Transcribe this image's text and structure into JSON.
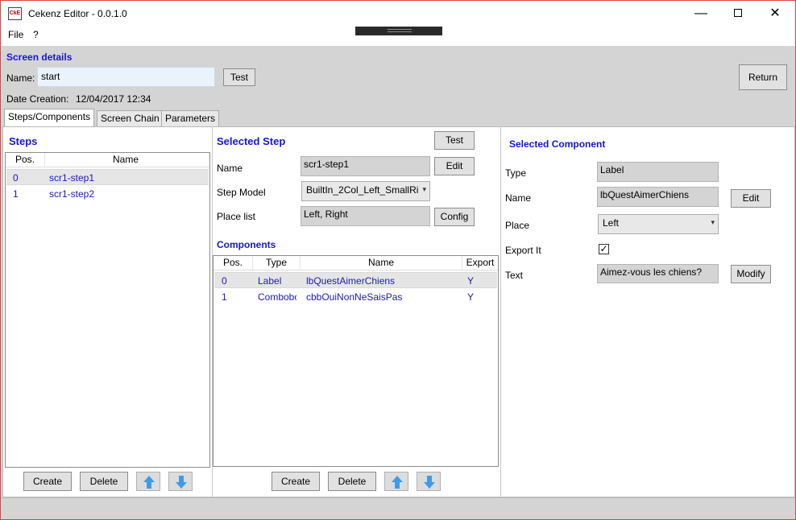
{
  "window": {
    "title": "Cekenz Editor - 0.0.1.0",
    "app_icon_text": "CkE",
    "minimize_glyph": "—",
    "close_glyph": "✕",
    "border_color": "#e0413f"
  },
  "menu": {
    "file": "File",
    "help": "?"
  },
  "screen_details": {
    "title": "Screen details",
    "name_label": "Name:",
    "name_value": "start",
    "test_button": "Test",
    "return_button": "Return",
    "date_label": "Date Creation:",
    "date_value": "12/04/2017 12:34"
  },
  "tabs": [
    {
      "label": "Steps/Components",
      "active": true
    },
    {
      "label": "Screen Chain",
      "active": false
    },
    {
      "label": "Parameters",
      "active": false
    }
  ],
  "steps": {
    "title": "Steps",
    "columns": [
      "Pos.",
      "Name"
    ],
    "rows": [
      {
        "pos": "0",
        "name": "scr1-step1",
        "selected": true
      },
      {
        "pos": "1",
        "name": "scr1-step2",
        "selected": false
      }
    ],
    "create_button": "Create",
    "delete_button": "Delete"
  },
  "selected_step": {
    "title": "Selected Step",
    "test_button": "Test",
    "name_label": "Name",
    "name_value": "scr1-step1",
    "edit_button": "Edit",
    "model_label": "Step Model",
    "model_value": "BuiltIn_2Col_Left_SmallRi",
    "place_label": "Place list",
    "place_value": "Left, Right",
    "config_button": "Config"
  },
  "components": {
    "title": "Components",
    "columns": [
      "Pos.",
      "Type",
      "Name",
      "Export"
    ],
    "rows": [
      {
        "pos": "0",
        "type": "Label",
        "name": "lbQuestAimerChiens",
        "export": "Y",
        "selected": true
      },
      {
        "pos": "1",
        "type": "Combobox",
        "name": "cbbOuiNonNeSaisPas",
        "export": "Y",
        "selected": false
      }
    ],
    "create_button": "Create",
    "delete_button": "Delete"
  },
  "selected_component": {
    "title": "Selected Component",
    "type_label": "Type",
    "type_value": "Label",
    "name_label": "Name",
    "name_value": "lbQuestAimerChiens",
    "edit_button": "Edit",
    "place_label": "Place",
    "place_value": "Left",
    "export_label": "Export It",
    "export_checked": "✓",
    "text_label": "Text",
    "text_value": "Aimez-vous les chiens?",
    "modify_button": "Modify"
  },
  "icons": {
    "arrow_up": "arrow-up-icon",
    "arrow_down": "arrow-down-icon",
    "caret": "▾"
  },
  "colors": {
    "section_title": "#1515d9",
    "row_text": "#1a1ab8",
    "arrow_fill": "#3f9be8"
  }
}
